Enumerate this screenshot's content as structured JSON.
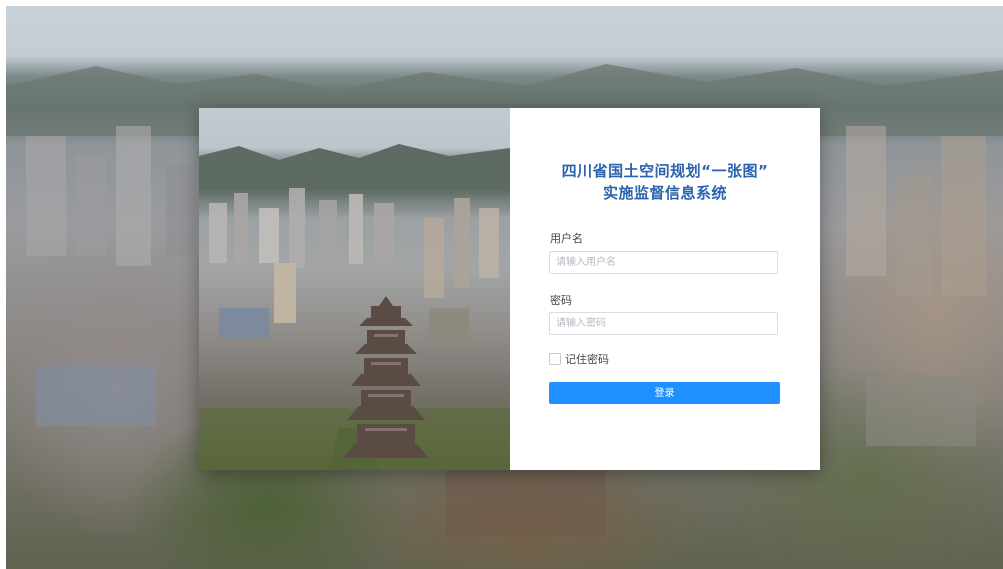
{
  "login": {
    "title_line1": "四川省国土空间规划“一张图”",
    "title_line2": "实施监督信息系统",
    "username_label": "用户名",
    "username_placeholder": "请输入用户名",
    "password_label": "密码",
    "password_placeholder": "请输入密码",
    "remember_label": "记住密码",
    "login_button": "登录"
  },
  "colors": {
    "title": "#2c63ad",
    "button": "#1e90ff"
  }
}
